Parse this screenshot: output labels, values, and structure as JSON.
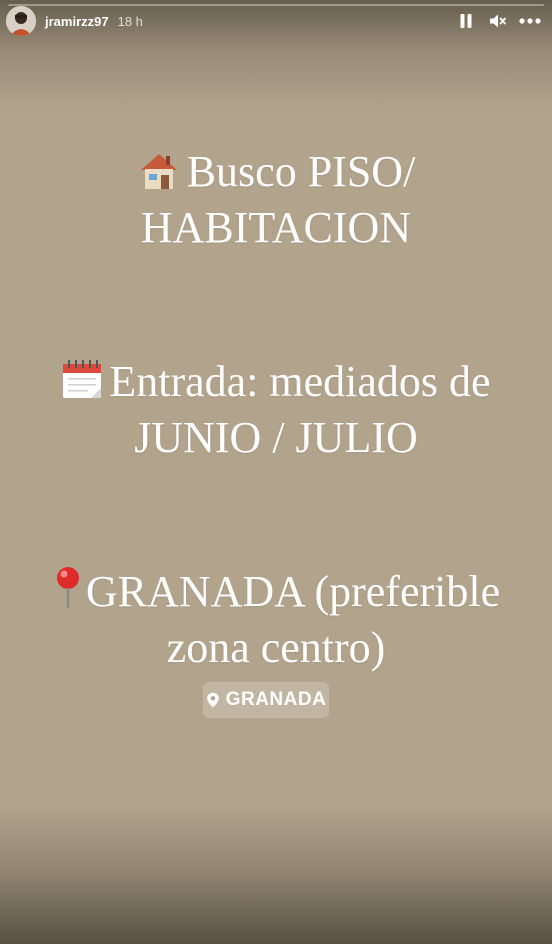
{
  "header": {
    "username": "jramirzz97",
    "time": "18 h",
    "progress": 0.0
  },
  "controls": {
    "pause_icon": "pause-icon",
    "mute_icon": "muted-speaker-icon",
    "more_icon": "more-options-icon"
  },
  "story": {
    "line1": {
      "emoji": "house-emoji",
      "text_a": "Busco PISO/",
      "text_b": "HABITACION"
    },
    "line2": {
      "emoji": "calendar-emoji",
      "text_a": "Entrada: mediados de",
      "text_b": "JUNIO / JULIO"
    },
    "line3": {
      "emoji": "pushpin-emoji",
      "text_a": "GRANADA (preferible",
      "text_b": "zona centro)"
    },
    "location_sticker": {
      "icon": "map-pin-icon",
      "label": "GRANADA"
    }
  },
  "colors": {
    "background": "#b2a48c",
    "text": "#ffffff"
  }
}
